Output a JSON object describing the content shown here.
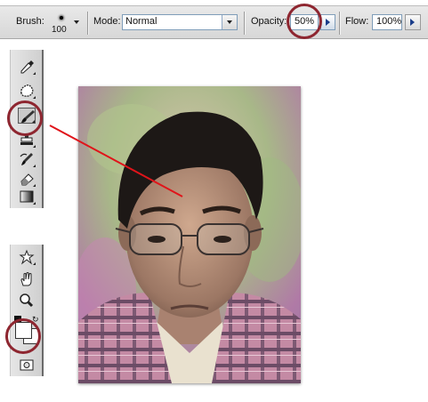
{
  "options_bar": {
    "brush_label": "Brush:",
    "brush_size": "100",
    "mode_label": "Mode:",
    "mode_value": "Normal",
    "opacity_label": "Opacity:",
    "opacity_value": "50%",
    "flow_label": "Flow:",
    "flow_value": "100%"
  },
  "toolbox_top": {
    "tools": [
      "eyedropper-icon",
      "patch-icon",
      "brush-icon",
      "clone-stamp-icon",
      "history-brush-icon",
      "eraser-icon",
      "gradient-icon"
    ],
    "selected": "brush-icon"
  },
  "toolbox_bottom": {
    "tools": [
      "custom-shape-icon",
      "hand-icon",
      "zoom-icon",
      "color-swatches",
      "quick-mask-icon"
    ],
    "foreground_color": "#ffffff",
    "background_color": "#ffffff"
  },
  "annotation": {
    "ring_color": "#8e2630",
    "line_color": "#e0141a",
    "highlighted": [
      "opacity-field",
      "brush-tool",
      "color-swatches"
    ]
  }
}
